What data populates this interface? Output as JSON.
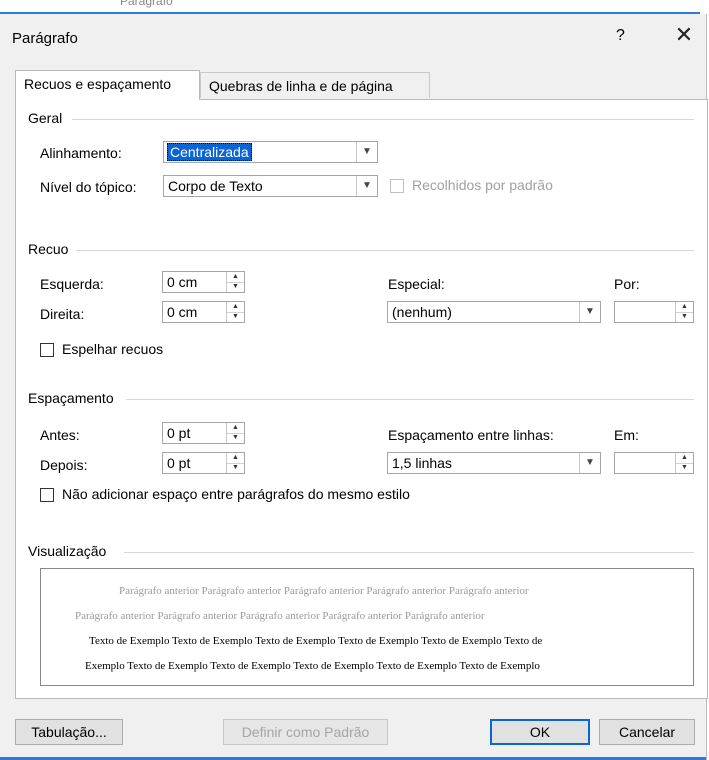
{
  "background_title": "Parágrafo",
  "dialog": {
    "title": "Parágrafo",
    "help_label": "?",
    "close_label": "✕"
  },
  "tabs": [
    {
      "label": "Recuos e espaçamento",
      "active": true
    },
    {
      "label": "Quebras de linha e de página",
      "active": false
    }
  ],
  "geral": {
    "section": "Geral",
    "alinhamento_label": "Alinhamento:",
    "alinhamento_value": "Centralizada",
    "nivel_label": "Nível do tópico:",
    "nivel_value": "Corpo de Texto",
    "recolhidos_label": "Recolhidos por padrão"
  },
  "recuo": {
    "section": "Recuo",
    "esquerda_label": "Esquerda:",
    "esquerda_value": "0 cm",
    "direita_label": "Direita:",
    "direita_value": "0 cm",
    "especial_label": "Especial:",
    "especial_value": "(nenhum)",
    "por_label": "Por:",
    "por_value": "",
    "espelhar_label": "Espelhar recuos"
  },
  "espacamento": {
    "section": "Espaçamento",
    "antes_label": "Antes:",
    "antes_value": "0 pt",
    "depois_label": "Depois:",
    "depois_value": "0 pt",
    "entre_linhas_label": "Espaçamento entre linhas:",
    "entre_linhas_value": "1,5 linhas",
    "em_label": "Em:",
    "em_value": "",
    "nao_adicionar_label": "Não adicionar espaço entre parágrafos do mesmo estilo"
  },
  "visualizacao": {
    "section": "Visualização",
    "line1": "Parágrafo anterior Parágrafo anterior Parágrafo anterior Parágrafo anterior Parágrafo anterior",
    "line2": "Parágrafo anterior Parágrafo anterior Parágrafo anterior Parágrafo anterior Parágrafo anterior",
    "line3": "Texto de Exemplo Texto de Exemplo Texto de Exemplo Texto de Exemplo Texto de Exemplo Texto de",
    "line4": "Exemplo Texto de Exemplo Texto de Exemplo Texto de Exemplo Texto de Exemplo Texto de Exemplo"
  },
  "buttons": {
    "tabulacao": "Tabulação...",
    "definir_padrao": "Definir como Padrão",
    "ok": "OK",
    "cancelar": "Cancelar"
  },
  "colors": {
    "accent": "#0a64d2",
    "dialog_bg": "#f0f0f0"
  }
}
